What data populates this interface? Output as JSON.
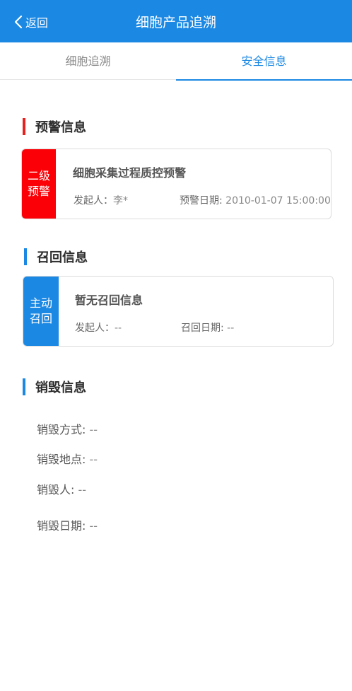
{
  "header": {
    "back_label": "返回",
    "title": "细胞产品追溯"
  },
  "tabs": [
    {
      "label": "细胞追溯",
      "active": false
    },
    {
      "label": "安全信息",
      "active": true
    }
  ],
  "warning": {
    "section_title": "预警信息",
    "accent": "#e8201e",
    "card": {
      "level_line1": "二级",
      "level_line2": "预警",
      "title": "细胞采集过程质控预警",
      "initiator_label": "发起人：",
      "initiator_value": "李*",
      "date_label": "预警日期:",
      "date_value": "2010-01-07 15:00:00"
    }
  },
  "recall": {
    "section_title": "召回信息",
    "accent": "#1b88e3",
    "card": {
      "type_line1": "主动",
      "type_line2": "召回",
      "title": "暂无召回信息",
      "initiator_label": "发起人：",
      "initiator_value": "--",
      "date_label": "召回日期:",
      "date_value": "--"
    }
  },
  "destroy": {
    "section_title": "销毁信息",
    "accent": "#1b88e3",
    "method_label": "销毁方式:",
    "method_value": "--",
    "location_label": "销毁地点:",
    "location_value": "--",
    "person_label": "销毁人:",
    "person_value": "--",
    "date_label": "销毁日期:",
    "date_value": "--"
  }
}
